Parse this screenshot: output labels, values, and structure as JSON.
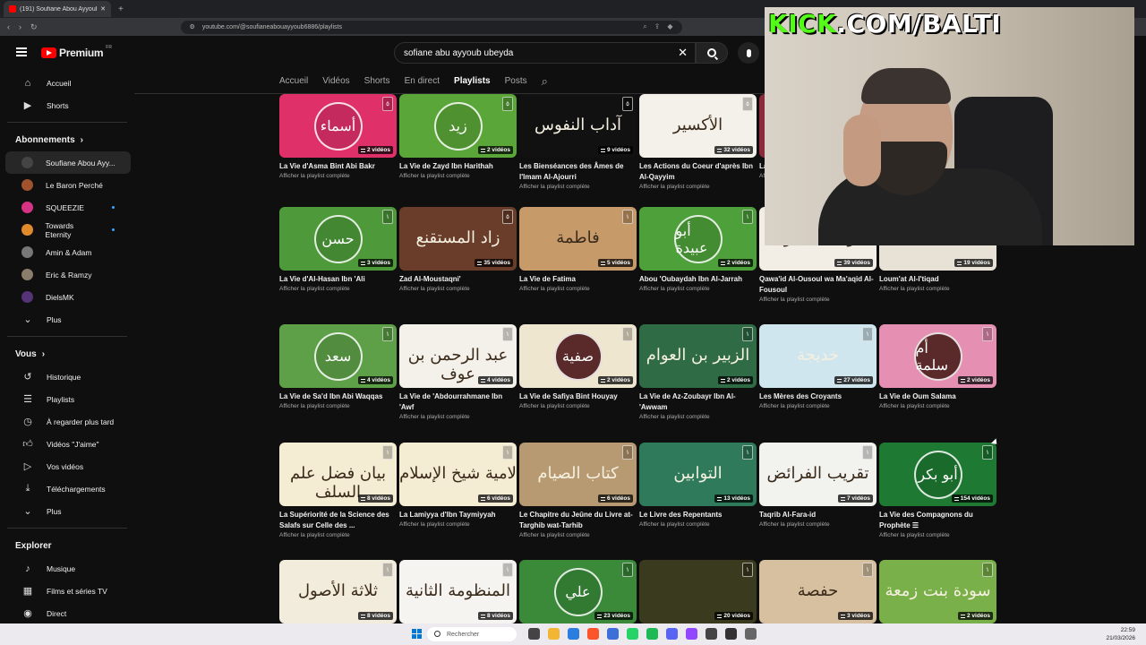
{
  "browser": {
    "tab_title": "(191) Soufiane Abou Ayyoub - Y",
    "url": "youtube.com/@soufianeabouayyoub6886/playlists"
  },
  "masthead": {
    "logo_text": "Premium",
    "logo_region": "FR",
    "search_value": "sofiane abu ayyoub ubeyda"
  },
  "sidebar": {
    "main": [
      {
        "label": "Accueil",
        "icon": "home-icon"
      },
      {
        "label": "Shorts",
        "icon": "shorts-icon"
      }
    ],
    "subs_header": "Abonnements",
    "subs": [
      {
        "label": "Soufiane Abou Ayy...",
        "color": "#444444",
        "active": true,
        "dot": false
      },
      {
        "label": "Le Baron Perché",
        "color": "#a0522d",
        "dot": false
      },
      {
        "label": "SQUEEZIE",
        "color": "#d63384",
        "dot": true
      },
      {
        "label": "Towards Eternity",
        "color": "#e08a2c",
        "dot": true
      },
      {
        "label": "Amin & Adam",
        "color": "#777777",
        "dot": false
      },
      {
        "label": "Eric & Ramzy",
        "color": "#8a7d6b",
        "dot": false
      },
      {
        "label": "DielsMK",
        "color": "#553377",
        "dot": false
      }
    ],
    "subs_more": "Plus",
    "you_header": "Vous",
    "you": [
      {
        "label": "Historique",
        "icon": "history-icon"
      },
      {
        "label": "Playlists",
        "icon": "playlists-icon"
      },
      {
        "label": "À regarder plus tard",
        "icon": "watch-later-icon"
      },
      {
        "label": "Vidéos \"J'aime\"",
        "icon": "like-icon"
      },
      {
        "label": "Vos vidéos",
        "icon": "your-videos-icon"
      },
      {
        "label": "Téléchargements",
        "icon": "download-icon"
      },
      {
        "label": "Plus",
        "icon": "chevron-down-icon"
      }
    ],
    "explore_header": "Explorer",
    "explore": [
      {
        "label": "Musique",
        "icon": "music-icon"
      },
      {
        "label": "Films et séries TV",
        "icon": "films-icon"
      },
      {
        "label": "Direct",
        "icon": "live-icon"
      }
    ]
  },
  "channel_tabs": [
    {
      "label": "Accueil",
      "active": false
    },
    {
      "label": "Vidéos",
      "active": false
    },
    {
      "label": "Shorts",
      "active": false
    },
    {
      "label": "En direct",
      "active": false
    },
    {
      "label": "Playlists",
      "active": true
    },
    {
      "label": "Posts",
      "active": false
    }
  ],
  "playlist_sub": "Afficher la playlist complète",
  "rows": [
    [
      {
        "title": "La Vie d'Asma Bint Abi Bakr",
        "count": "2 vidéos",
        "bg": "#e0306a",
        "style": "medallion",
        "art": "أسماء",
        "tag": "٥"
      },
      {
        "title": "La Vie de Zayd Ibn Harithah",
        "count": "2 vidéos",
        "bg": "#5aa638",
        "style": "medallion",
        "art": "زيد",
        "tag": "٥"
      },
      {
        "title": "Les Bienséances des Âmes de l'Imam Al-Ajourri",
        "count": "9 vidéos",
        "bg": "#111111",
        "style": "calli",
        "art": "آداب النفوس",
        "tag": "٥"
      },
      {
        "title": "Les Actions du Coeur d'après Ibn Al-Qayyim",
        "count": "32 vidéos",
        "bg": "#f4f1ea",
        "style": "calli",
        "art": "الأكسير",
        "tag": "٥",
        "dark": true
      },
      {
        "title": "La Vie de...",
        "count": "",
        "bg": "#8a2a3a",
        "style": "calli",
        "art": "",
        "tag": ""
      }
    ],
    [
      {
        "title": "La Vie d'Al-Hasan Ibn 'Ali",
        "count": "3 vidéos",
        "bg": "#4e9a3a",
        "style": "medallion",
        "art": "حسن",
        "tag": "١"
      },
      {
        "title": "Zad Al-Moustaqni'",
        "count": "35 vidéos",
        "bg": "#6a3c2a",
        "style": "calli",
        "art": "زاد المستقنع",
        "tag": "٥"
      },
      {
        "title": "La Vie de Fatima",
        "count": "5 vidéos",
        "bg": "#c79a6a",
        "style": "calli",
        "art": "فاطمة",
        "tag": "١",
        "dark": true
      },
      {
        "title": "Abou 'Oubaydah Ibn Al-Jarrah",
        "count": "2 vidéos",
        "bg": "#4ea03a",
        "style": "medallion",
        "art": "أبو عبيدة",
        "tag": "١"
      },
      {
        "title": "Qawa'id Al-Ousoul wa Ma'aqid Al-Fousoul",
        "count": "39 vidéos",
        "bg": "#f2eee6",
        "style": "calli",
        "art": "قواعد الأصول",
        "tag": "٥",
        "dark": true
      },
      {
        "title": "Loum'at Al-I'tiqad",
        "count": "19 vidéos",
        "bg": "#e8e2d6",
        "style": "calli",
        "art": "لمعة الاعتقاد",
        "tag": "٥",
        "dark": true
      }
    ],
    [
      {
        "title": "La Vie de Sa'd Ibn Abi Waqqas",
        "count": "4 vidéos",
        "bg": "#5ea048",
        "style": "medallion",
        "art": "سعد",
        "tag": "١"
      },
      {
        "title": "La Vie de 'Abdourrahmane Ibn 'Awf",
        "count": "4 vidéos",
        "bg": "#f4f1ea",
        "style": "calli",
        "art": "عبد الرحمن بن عوف",
        "tag": "١",
        "dark": true
      },
      {
        "title": "La Vie de Safiya Bint Houyay",
        "count": "2 vidéos",
        "bg": "#efe6cf",
        "style": "medallion",
        "art": "صفية",
        "tag": "١",
        "medbg": "#5a2a2a"
      },
      {
        "title": "La Vie de Az-Zoubayr Ibn Al-'Awwam",
        "count": "2 vidéos",
        "bg": "#2f6b44",
        "style": "calli",
        "art": "الزبير بن العوام",
        "tag": "١"
      },
      {
        "title": "Les Mères des Croyants",
        "count": "27 vidéos",
        "bg": "#cfe6ef",
        "style": "calli",
        "art": "خديجة",
        "tag": "١"
      },
      {
        "title": "La Vie de Oum Salama",
        "count": "2 vidéos",
        "bg": "#e58fb3",
        "style": "medallion",
        "art": "أم سلمة",
        "tag": "١",
        "medbg": "#5a2a2a"
      }
    ],
    [
      {
        "title": "La Supériorité de la Science des Salafs sur Celle des ...",
        "count": "8 vidéos",
        "bg": "#f5ecd4",
        "style": "calli",
        "art": "بيان فضل علم السلف",
        "tag": "١",
        "dark": true
      },
      {
        "title": "La Lamiyya d'Ibn Taymiyyah",
        "count": "6 vidéos",
        "bg": "#f5ecd4",
        "style": "calli",
        "art": "لامية شيخ الإسلام",
        "tag": "١",
        "dark": true
      },
      {
        "title": "Le Chapitre du Jeûne du Livre at-Targhib wat-Tarhib",
        "count": "6 vidéos",
        "bg": "#b89a72",
        "style": "calli",
        "art": "كتاب الصيام",
        "tag": "١"
      },
      {
        "title": "Le Livre des Repentants",
        "count": "13 vidéos",
        "bg": "#2f7a5a",
        "style": "calli",
        "art": "التوابين",
        "tag": "١"
      },
      {
        "title": "Taqrib Al-Fara-id",
        "count": "7 vidéos",
        "bg": "#f2f2ee",
        "style": "calli",
        "art": "تقريب الفرائض",
        "tag": "١",
        "dark": true
      },
      {
        "title": "La Vie des Compagnons du Prophète ☰",
        "count": "154 vidéos",
        "bg": "#1e7a32",
        "style": "medallion",
        "art": "أبو بكر",
        "tag": "١"
      }
    ],
    [
      {
        "title": "",
        "count": "8 vidéos",
        "bg": "#f2ecdc",
        "style": "calli",
        "art": "ثلاثة الأصول",
        "tag": "١",
        "dark": true
      },
      {
        "title": "",
        "count": "8 vidéos",
        "bg": "#f6f4f0",
        "style": "calli",
        "art": "المنظومة الثانية",
        "tag": "١",
        "dark": true
      },
      {
        "title": "",
        "count": "23 vidéos",
        "bg": "#3a8a3a",
        "style": "medallion",
        "art": "علي",
        "tag": "١"
      },
      {
        "title": "",
        "count": "20 vidéos",
        "bg": "#3a3a1e",
        "style": "calli",
        "art": "",
        "tag": "١"
      },
      {
        "title": "",
        "count": "3 vidéos",
        "bg": "#d6c0a0",
        "style": "calli",
        "art": "حفصة",
        "tag": "١",
        "dark": true
      },
      {
        "title": "",
        "count": "2 vidéos",
        "bg": "#7ab04a",
        "style": "calli",
        "art": "سودة بنت زمعة",
        "tag": "١"
      }
    ]
  ],
  "overlay": {
    "kick_prefix": "KICK",
    "kick_suffix": ".COM/BALTI"
  },
  "taskbar": {
    "search_placeholder": "Rechercher",
    "time": "22:59",
    "date": "21/03/2026"
  }
}
